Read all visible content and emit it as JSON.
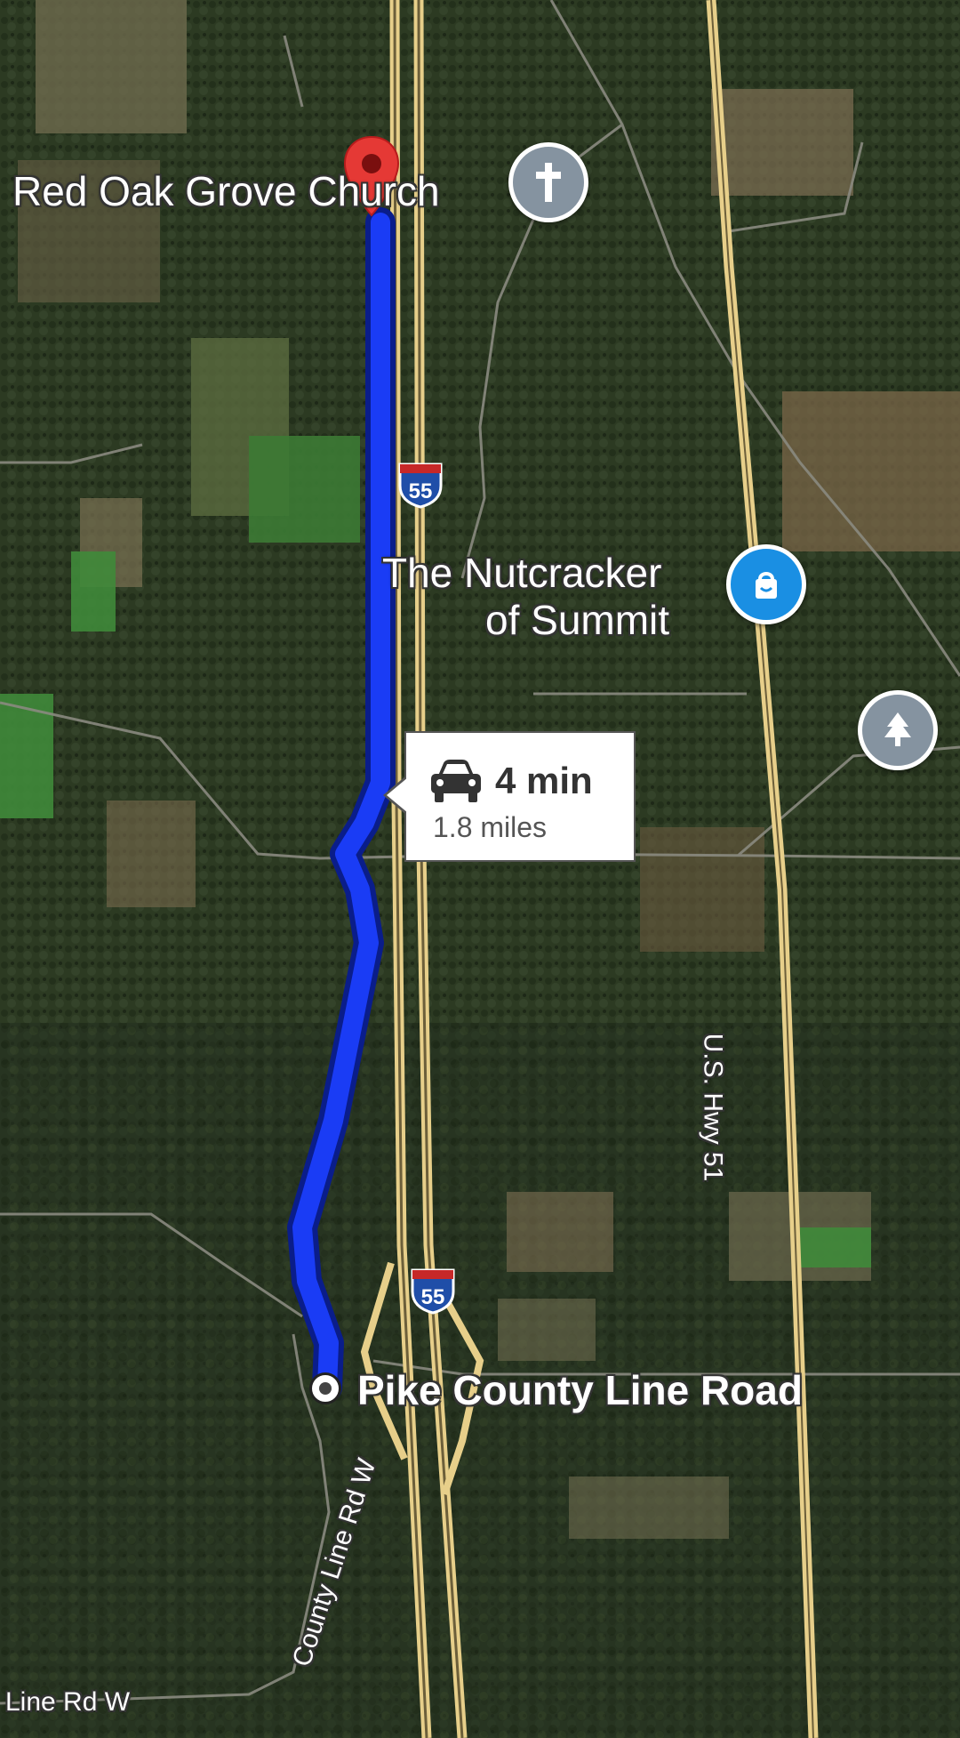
{
  "places": {
    "church": "Red Oak Grove Church",
    "nutcracker_line1": "The Nutcracker",
    "nutcracker_line2": "of Summit",
    "destination_start": "Pike County Line Road"
  },
  "roads": {
    "interstate_number": "55",
    "us_hwy": "U.S. Hwy 51",
    "county_line_road": "County Line Rd W",
    "line_rd_w": "Line Rd W"
  },
  "route": {
    "duration": "4 min",
    "distance": "1.8 miles",
    "color": "#1a3cf5"
  },
  "icons": {
    "church": "cross-icon",
    "shopping": "shopping-bag-icon",
    "park": "tree-icon",
    "destination": "red-pin-icon",
    "origin": "origin-dot-icon",
    "car": "car-icon"
  },
  "colors": {
    "shopping_pin": "#1a8fe3",
    "church_pin": "#8593a0",
    "park_pin": "#8593a0",
    "destination_pin": "#e53935"
  }
}
